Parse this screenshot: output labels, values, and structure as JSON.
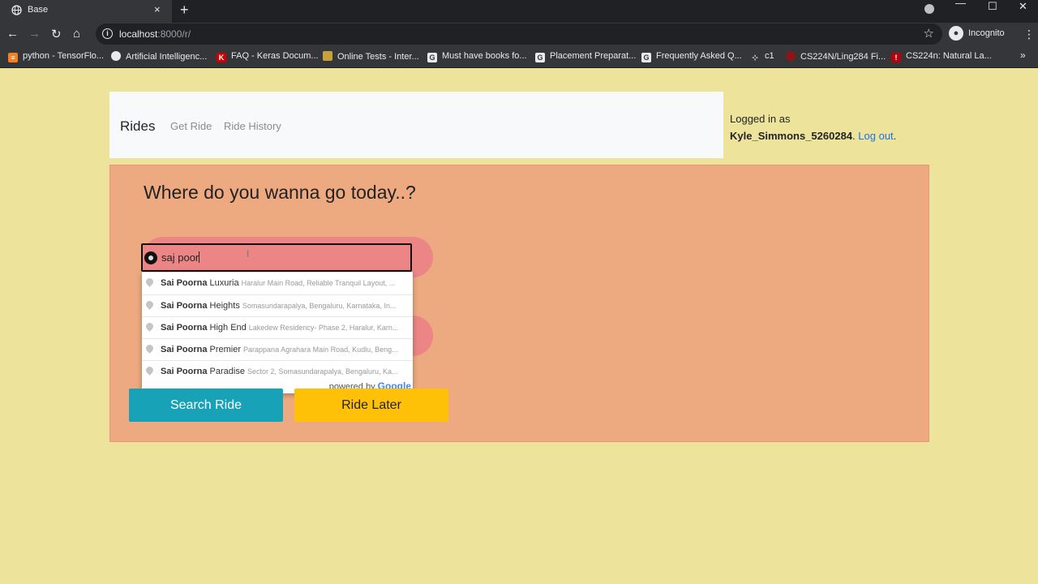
{
  "browser": {
    "tab_title": "Base",
    "tab_close": "×",
    "new_tab": "+",
    "url_host": "localhost",
    "url_rest": ":8000/r/",
    "profile_label": "Incognito",
    "bookmarks": [
      {
        "label": "python - TensorFlo...",
        "icon": "stackoverflow-icon",
        "color": "#f48024"
      },
      {
        "label": "Artificial Intelligenc...",
        "icon": "site-icon",
        "color": "#e8eaed"
      },
      {
        "label": "FAQ - Keras Docum...",
        "icon": "keras-icon",
        "color": "#d00000"
      },
      {
        "label": "Online Tests - Inter...",
        "icon": "site-icon",
        "color": "#c9a13b"
      },
      {
        "label": "Must have books fo...",
        "icon": "gfg-icon",
        "color": "#e8eaed"
      },
      {
        "label": "Placement Preparat...",
        "icon": "gfg-icon",
        "color": "#e8eaed"
      },
      {
        "label": "Frequently Asked Q...",
        "icon": "gfg-icon",
        "color": "#e8eaed"
      },
      {
        "label": "c1",
        "icon": "site-icon",
        "color": "#e8eaed"
      },
      {
        "label": "CS224N/Ling284 Fi...",
        "icon": "stanford-icon",
        "color": "#8c1515"
      },
      {
        "label": "CS224n: Natural La...",
        "icon": "stanford-icon",
        "color": "#b1040e"
      }
    ]
  },
  "navbar": {
    "brand": "Rides",
    "links": [
      "Get Ride",
      "Ride History"
    ]
  },
  "user": {
    "logged_in_text": "Logged in as",
    "username": "Kyle_Simmons_5260284",
    "logout": "Log out"
  },
  "main": {
    "heading": "Where do you wanna go today..?",
    "search_value": "saj poor",
    "suggestions": [
      {
        "bold": "Sai Poorna",
        "rest": " Luxuria",
        "secondary": "Haralur Main Road, Reliable Tranquil Layout, ..."
      },
      {
        "bold": "Sai Poorna",
        "rest": " Heights",
        "secondary": "Somasundarapalya, Bengaluru, Karnataka, In..."
      },
      {
        "bold": "Sai Poorna",
        "rest": " High End",
        "secondary": "Lakedew Residency- Phase 2, Haralur, Karn..."
      },
      {
        "bold": "Sai Poorna",
        "rest": " Premier",
        "secondary": "Parappana Agrahara Main Road, Kudlu, Beng..."
      },
      {
        "bold": "Sai Poorna",
        "rest": " Paradise",
        "secondary": "Sector 2, Somasundarapalya, Bengaluru, Ka..."
      }
    ],
    "powered_by": "powered by",
    "google": "Google",
    "search_button": "Search Ride",
    "later_button": "Ride Later"
  }
}
